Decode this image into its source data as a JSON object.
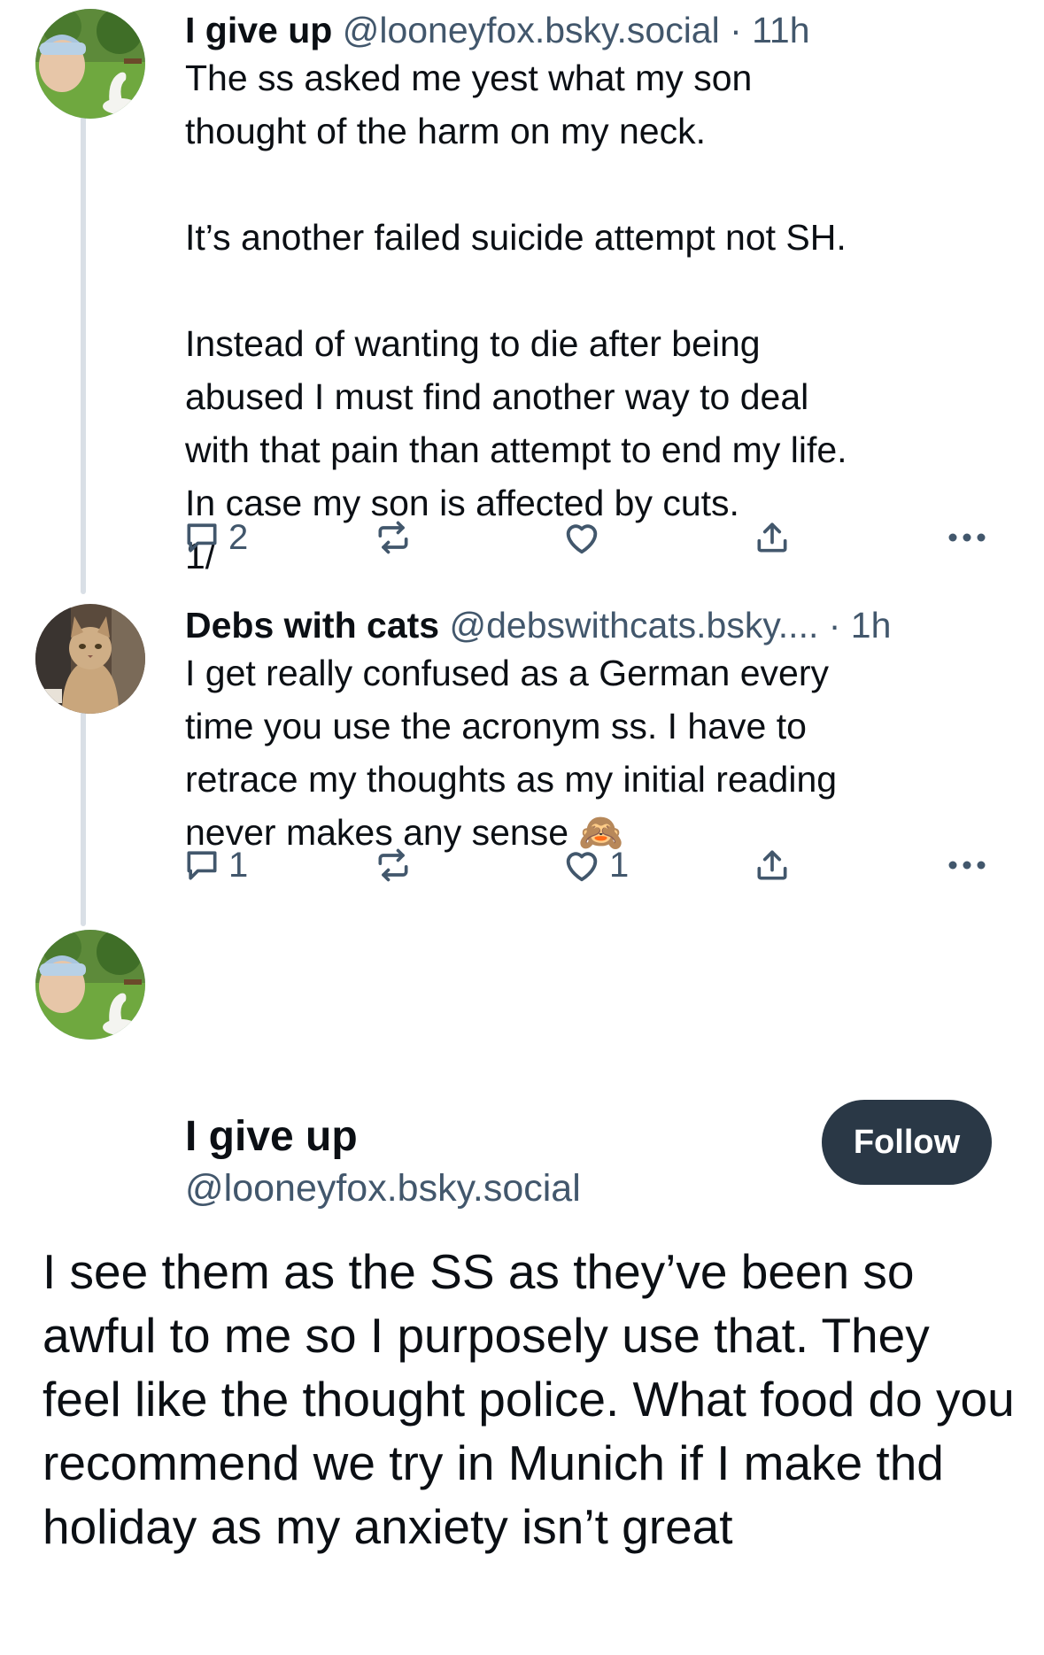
{
  "posts": [
    {
      "author": "I give up",
      "handle": "@looneyfox.bsky.social",
      "separator": " · ",
      "time": "11h",
      "text": "The ss asked me yest what my son\nthought of the harm on my neck.\n\nIt’s another failed suicide attempt not SH.\n\nInstead of wanting to die after being\nabused I must find another way to deal\nwith that pain than attempt to end my life.\nIn case my son is affected by cuts.\n1/",
      "replies": "2",
      "likes": ""
    },
    {
      "author": "Debs with cats",
      "handle": "@debswithcats.bsky....",
      "separator": " · ",
      "time": "1h",
      "text": "I get really confused as a German every\ntime you use the acronym ss. I have to\nretrace my thoughts as my initial reading\nnever makes any sense 🙈",
      "replies": "1",
      "likes": "1"
    }
  ],
  "main_post": {
    "author": "I give up",
    "handle": "@looneyfox.bsky.social",
    "follow_label": "Follow",
    "text": "I see them as the SS as they’ve been so awful to me so I purposely use that. They feel like the thought police.  What food do you recommend we try in Munich if I make thd holiday as my anxiety isn’t great"
  },
  "icons": {
    "reply": "reply-bubble-icon",
    "repost": "repost-icon",
    "like": "heart-icon",
    "share": "share-icon",
    "more": "more-dots-icon"
  },
  "colors": {
    "text": "#0b0f14",
    "muted": "#42576c",
    "thread_line": "#d9dfe6",
    "follow_bg": "#2a3846"
  }
}
